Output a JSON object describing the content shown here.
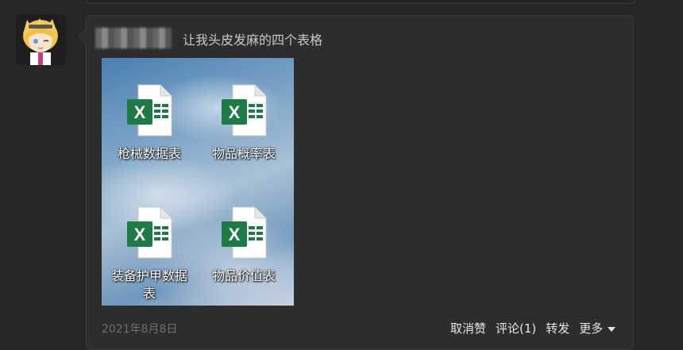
{
  "post": {
    "text": "让我头皮发麻的四个表格"
  },
  "files": [
    {
      "name": "枪械数据表",
      "icon": "excel-icon"
    },
    {
      "name": "物品概率表",
      "icon": "excel-icon"
    },
    {
      "name": "装备护甲数据表",
      "icon": "excel-icon"
    },
    {
      "name": "物品价值表",
      "icon": "excel-icon"
    }
  ],
  "footer": {
    "date": "2021年8月8日",
    "cancel_like": "取消赞",
    "comment": "评论(1)",
    "forward": "转发",
    "more": "更多"
  },
  "colors": {
    "background": "#262626",
    "card": "#2d2d2d",
    "excel_green": "#1e7b45"
  }
}
